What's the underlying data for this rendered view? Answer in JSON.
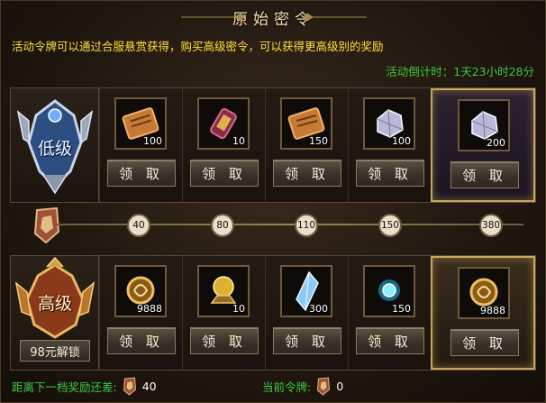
{
  "title": "原始密令",
  "description": "活动令牌可以通过合服悬赏获得，购买高级密令，可以获得更高级别的奖励",
  "countdown": "活动倒计时：1天23小时28分",
  "tiers": {
    "low": {
      "label": "低级",
      "icon": "low-tier-emblem"
    },
    "high": {
      "label": "高级",
      "icon": "high-tier-emblem",
      "unlock_label": "98元解锁"
    }
  },
  "claim_label": "领 取",
  "low_rewards": [
    {
      "icon": "scroll",
      "qty": "100"
    },
    {
      "icon": "bracer",
      "qty": "10"
    },
    {
      "icon": "scroll",
      "qty": "150"
    },
    {
      "icon": "crystal-ore",
      "qty": "100"
    },
    {
      "icon": "crystal-ore",
      "qty": "200"
    }
  ],
  "high_rewards": [
    {
      "icon": "gold-rune",
      "qty": "9888"
    },
    {
      "icon": "golden-orb",
      "qty": "10"
    },
    {
      "icon": "ice-crystal",
      "qty": "300"
    },
    {
      "icon": "blue-gem",
      "qty": "150"
    },
    {
      "icon": "gold-rune",
      "qty": "9888"
    }
  ],
  "milestones": [
    "40",
    "80",
    "110",
    "150",
    "380"
  ],
  "footer": {
    "next_label": "距离下一档奖励还差:",
    "next_value": "40",
    "current_label": "当前令牌:",
    "current_value": "0"
  },
  "colors": {
    "highlight_text": "#ffe23a",
    "green_text": "#3ec93e",
    "gold_border": "#c9a65b"
  }
}
